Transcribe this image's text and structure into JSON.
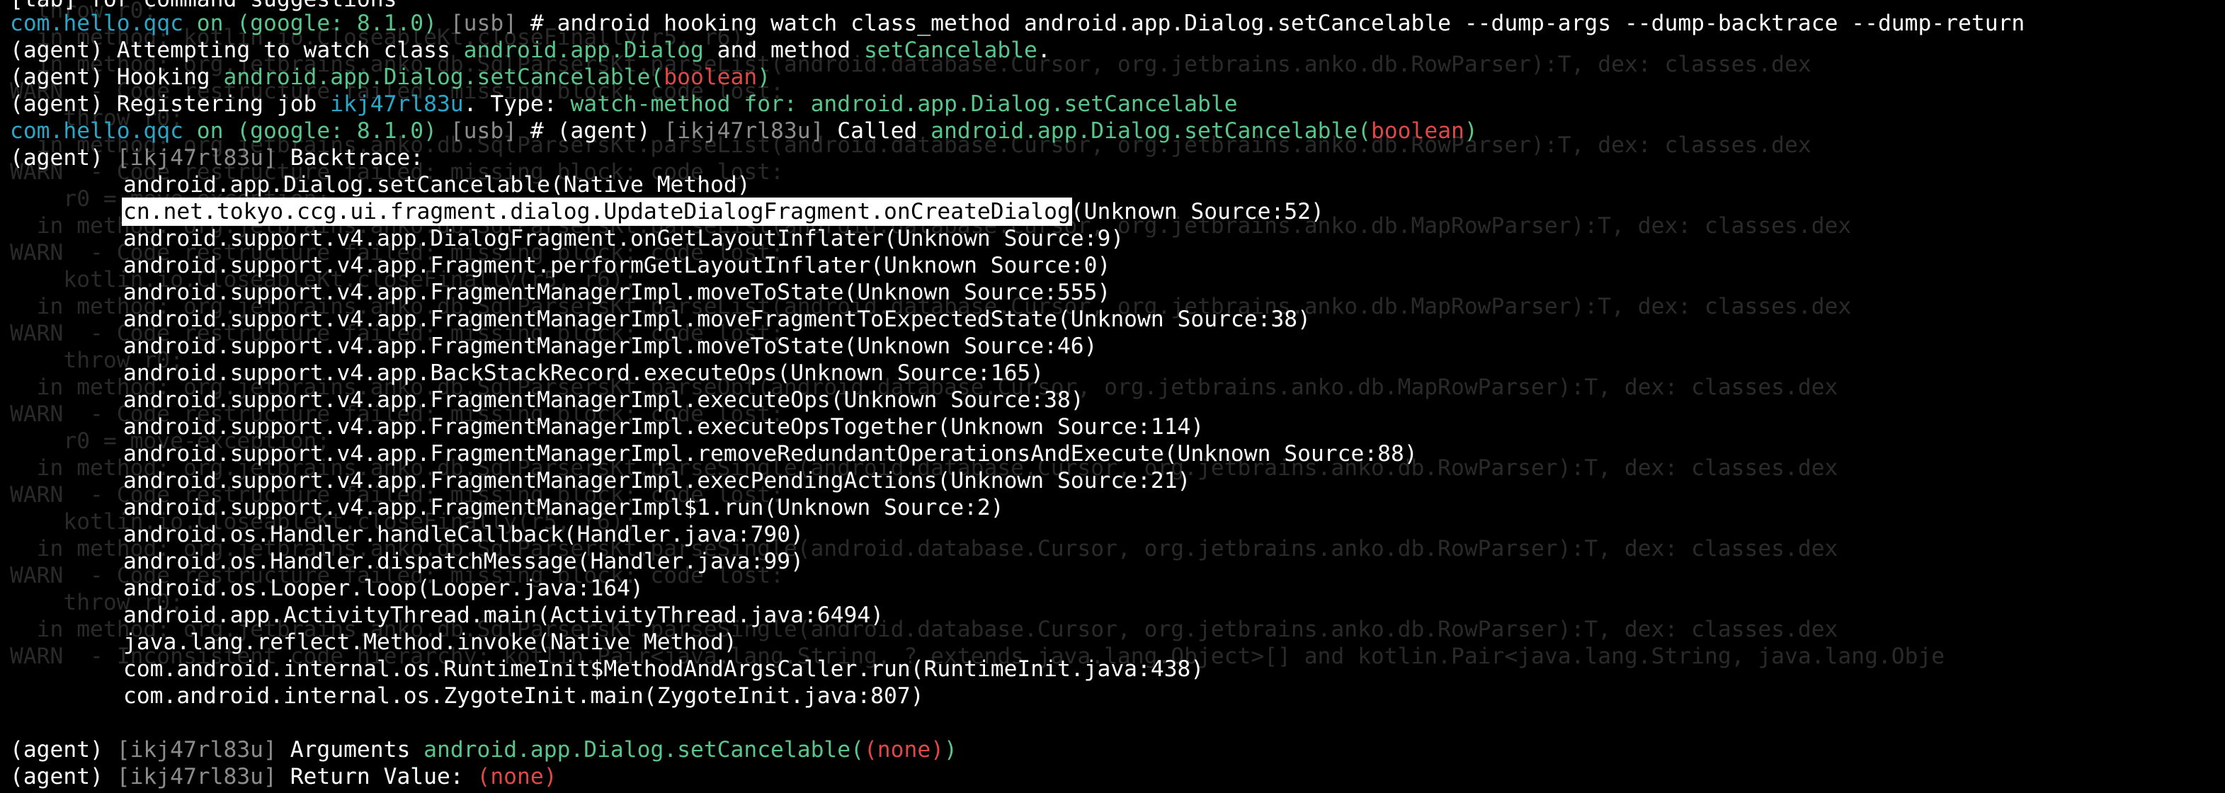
{
  "ghost_lines": [
    "  throw r0;",
    "  in method: kotlin.io.CloseableKt.closeFinally(r5, r6);",
    "  in method: org.jetbrains.anko.db.SqlParsersKt.parseList(android.database.Cursor, org.jetbrains.anko.db.RowParser):T, dex: classes.dex",
    "WARN  - Code restructure failed: missing block: code lost:",
    "    throw r0;",
    "  in method: org.jetbrains.anko.db.SqlParsersKt.parseList(android.database.Cursor, org.jetbrains.anko.db.RowParser):T, dex: classes.dex",
    "WARN  - Code restructure failed: missing block: code lost:",
    "    r0 = move-exception;",
    "  in method: org.jetbrains.anko.db.SqlParsersKt.parseList(android.database.Cursor, org.jetbrains.anko.db.MapRowParser):T, dex: classes.dex",
    "WARN  - Code restructure failed: missing block: code lost:",
    "    kotlin.io.CloseableKt.closeFinally(r5, r6);",
    "  in method: org.jetbrains.anko.db.SqlParsersKt.parseList(android.database.Cursor, org.jetbrains.anko.db.MapRowParser):T, dex: classes.dex",
    "WARN  - Code restructure failed: missing block: code lost:",
    "    throw r0;",
    "  in method: org.jetbrains.anko.db.SqlParsersKt.parseOpt(android.database.Cursor, org.jetbrains.anko.db.MapRowParser):T, dex: classes.dex",
    "WARN  - Code restructure failed: missing block: code lost:",
    "    r0 = move-exception;",
    "  in method: org.jetbrains.anko.db.SqlParsersKt.parseSingle(android.database.Cursor, org.jetbrains.anko.db.RowParser):T, dex: classes.dex",
    "WARN  - Code restructure failed: missing block: code lost:",
    "    kotlin.io.CloseableKt.closeFinally(r5, r6);",
    "  in method: org.jetbrains.anko.db.SqlParsersKt.parseSingle(android.database.Cursor, org.jetbrains.anko.db.RowParser):T, dex: classes.dex",
    "WARN  - Code restructure failed: missing block: code lost:",
    "    throw r0;",
    "  in method: org.jetbrains.anko.db.SqlParsersKt.parseSingle(android.database.Cursor, org.jetbrains.anko.db.RowParser):T, dex: classes.dex",
    "WARN  - Inconsistent code hierarchy: kotlin.Pair<java.lang.String, ? extends java.lang.Object>[] and kotlin.Pair<java.lang.String, java.lang.Obje"
  ],
  "top_partial": "[tab] for command suggestions",
  "prompt1": {
    "app": "com.hello.qqc",
    "on": "on",
    "device": "(google: 8.1.0)",
    "conn": "[usb]",
    "hash": "#",
    "command": "android hooking watch class_method android.app.Dialog.setCancelable --dump-args --dump-backtrace --dump-return"
  },
  "attempt": {
    "prefix": "(agent) Attempting to watch class",
    "class_name": "android.app.Dialog",
    "mid": "and method",
    "method_name": "setCancelable",
    "end": "."
  },
  "hooking": {
    "prefix": "(agent) Hooking",
    "target": "android.app.Dialog.setCancelable",
    "open": "(",
    "arg": "boolean",
    "close": ")"
  },
  "register": {
    "prefix": "(agent) Registering job",
    "job": "ikj47rl83u",
    "type_label": ". Type:",
    "type_value": "watch-method for:",
    "target": "android.app.Dialog.setCancelable"
  },
  "prompt2": {
    "app": "com.hello.qqc",
    "on": "on",
    "device": "(google: 8.1.0)",
    "conn": "[usb]",
    "hash": "#",
    "agent": "(agent)",
    "job": "[ikj47rl83u]",
    "called": "Called",
    "target": "android.app.Dialog.setCancelable",
    "open": "(",
    "arg": "boolean",
    "close": ")"
  },
  "backtrace_header": {
    "agent": "(agent)",
    "job": "[ikj47rl83u]",
    "label": "Backtrace:"
  },
  "backtrace_selected": {
    "method": "cn.net.tokyo.ccg.ui.fragment.dialog.UpdateDialogFragment.onCreateDialog",
    "source": "(Unknown Source:52)"
  },
  "backtrace": [
    "android.app.Dialog.setCancelable(Native Method)",
    "cn.net.tokyo.ccg.ui.fragment.dialog.UpdateDialogFragment.onCreateDialog(Unknown Source:52)",
    "android.support.v4.app.DialogFragment.onGetLayoutInflater(Unknown Source:9)",
    "android.support.v4.app.Fragment.performGetLayoutInflater(Unknown Source:0)",
    "android.support.v4.app.FragmentManagerImpl.moveToState(Unknown Source:555)",
    "android.support.v4.app.FragmentManagerImpl.moveFragmentToExpectedState(Unknown Source:38)",
    "android.support.v4.app.FragmentManagerImpl.moveToState(Unknown Source:46)",
    "android.support.v4.app.BackStackRecord.executeOps(Unknown Source:165)",
    "android.support.v4.app.FragmentManagerImpl.executeOps(Unknown Source:38)",
    "android.support.v4.app.FragmentManagerImpl.executeOpsTogether(Unknown Source:114)",
    "android.support.v4.app.FragmentManagerImpl.removeRedundantOperationsAndExecute(Unknown Source:88)",
    "android.support.v4.app.FragmentManagerImpl.execPendingActions(Unknown Source:21)",
    "android.support.v4.app.FragmentManagerImpl$1.run(Unknown Source:2)",
    "android.os.Handler.handleCallback(Handler.java:790)",
    "android.os.Handler.dispatchMessage(Handler.java:99)",
    "android.os.Looper.loop(Looper.java:164)",
    "android.app.ActivityThread.main(ActivityThread.java:6494)",
    "java.lang.reflect.Method.invoke(Native Method)",
    "com.android.internal.os.RuntimeInit$MethodAndArgsCaller.run(RuntimeInit.java:438)",
    "com.android.internal.os.ZygoteInit.main(ZygoteInit.java:807)"
  ],
  "arguments": {
    "agent": "(agent)",
    "job": "[ikj47rl83u]",
    "label": "Arguments",
    "target": "android.app.Dialog.setCancelable",
    "open": "(",
    "value": "(none)",
    "close": ")"
  },
  "return_value": {
    "agent": "(agent)",
    "job": "[ikj47rl83u]",
    "label": "Return Value:",
    "value": "(none)"
  }
}
